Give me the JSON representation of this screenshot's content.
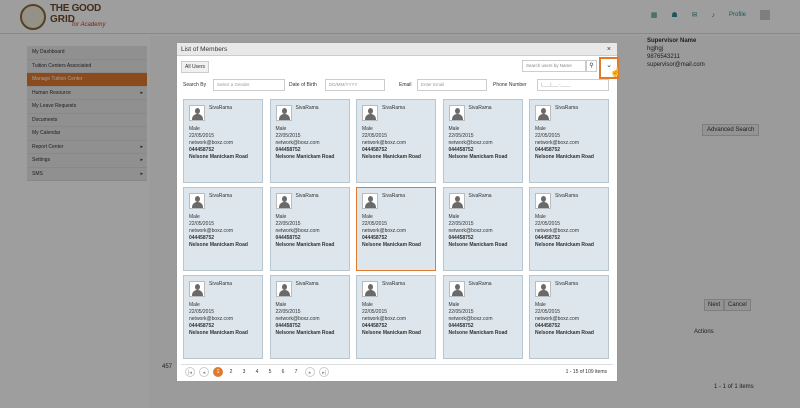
{
  "logo": {
    "line1": "THE GOOD",
    "line2": "GRID",
    "tag": "for Academy"
  },
  "topbar": {
    "profile": "Profile"
  },
  "sidebar": {
    "items": [
      {
        "label": "My Dashboard",
        "arrow": ""
      },
      {
        "label": "Tuition Centers Associated",
        "arrow": ""
      },
      {
        "label": "Manage Tuition Center",
        "arrow": ""
      },
      {
        "label": "Human Resource",
        "arrow": "▸"
      },
      {
        "label": "My Leave Requests",
        "arrow": ""
      },
      {
        "label": "Documents",
        "arrow": ""
      },
      {
        "label": "My Calendar",
        "arrow": ""
      },
      {
        "label": "Report Center",
        "arrow": "▸"
      },
      {
        "label": "Settings",
        "arrow": "▸"
      },
      {
        "label": "SMS",
        "arrow": "▸"
      }
    ]
  },
  "background": {
    "supervisor_title": "Supervisor Name",
    "supervisor_name": "hgjhgj",
    "supervisor_phone": "9876543211",
    "supervisor_email": "supervisor@mail.com",
    "advanced_search": "Advanced Search",
    "next": "Next",
    "cancel": "Cancel",
    "actions": "Actions",
    "row_id": "457",
    "pager_right": "1 - 1 of 1 items"
  },
  "modal": {
    "title": "List of Members",
    "close": "×",
    "all_users": "All Users",
    "search_placeholder": "Search users by Name",
    "filters": {
      "search_by": "Search By",
      "gender_placeholder": "Select a Gender",
      "dob_label": "Date of Birth",
      "dob_placeholder": "DD/MM/YYYY",
      "email_label": "Email",
      "email_placeholder": "Enter Email",
      "phone_label": "Phone Number",
      "phone_placeholder": "(___)___-____"
    },
    "cards": [
      {
        "name": "SivaRama",
        "gender": "Male",
        "date": "22/05/2015",
        "email": "network@boxz.com",
        "phone": "044458752",
        "address": "Nelsone Manickam Road"
      },
      {
        "name": "SivaRama",
        "gender": "Male",
        "date": "22/05/2015",
        "email": "network@boxz.com",
        "phone": "044458752",
        "address": "Nelsone Manickam Road"
      },
      {
        "name": "SivaRama",
        "gender": "Male",
        "date": "22/05/2015",
        "email": "network@boxz.com",
        "phone": "044458752",
        "address": "Nelsone Manickam Road"
      },
      {
        "name": "SivaRama",
        "gender": "Male",
        "date": "22/05/2015",
        "email": "network@boxz.com",
        "phone": "044458752",
        "address": "Nelsone Manickam Road"
      },
      {
        "name": "SivaRama",
        "gender": "Male",
        "date": "22/05/2015",
        "email": "network@boxz.com",
        "phone": "044458752",
        "address": "Nelsone Manickam Road"
      },
      {
        "name": "SivaRama",
        "gender": "Male",
        "date": "22/05/2015",
        "email": "network@boxz.com",
        "phone": "044458752",
        "address": "Nelsone Manickam Road"
      },
      {
        "name": "SivaRama",
        "gender": "Male",
        "date": "22/05/2015",
        "email": "network@boxz.com",
        "phone": "044458752",
        "address": "Nelsone Manickam Road"
      },
      {
        "name": "SivaRama",
        "gender": "Male",
        "date": "22/05/2015",
        "email": "network@boxz.com",
        "phone": "044458752",
        "address": "Nelsone Manickam Road"
      },
      {
        "name": "SivaRama",
        "gender": "Male",
        "date": "22/05/2015",
        "email": "network@boxz.com",
        "phone": "044458752",
        "address": "Nelsone Manickam Road"
      },
      {
        "name": "SivaRama",
        "gender": "Male",
        "date": "22/05/2015",
        "email": "network@boxz.com",
        "phone": "044458752",
        "address": "Nelsone Manickam Road"
      },
      {
        "name": "SivaRama",
        "gender": "Male",
        "date": "22/05/2015",
        "email": "network@boxz.com",
        "phone": "044458752",
        "address": "Nelsone Manickam Road"
      },
      {
        "name": "SivaRama",
        "gender": "Male",
        "date": "22/05/2015",
        "email": "network@boxz.com",
        "phone": "044458752",
        "address": "Nelsone Manickam Road"
      },
      {
        "name": "SivaRama",
        "gender": "Male",
        "date": "22/05/2015",
        "email": "network@boxz.com",
        "phone": "044458752",
        "address": "Nelsone Manickam Road"
      },
      {
        "name": "SivaRama",
        "gender": "Male",
        "date": "22/05/2015",
        "email": "network@boxz.com",
        "phone": "044458752",
        "address": "Nelsone Manickam Road"
      },
      {
        "name": "SivaRama",
        "gender": "Male",
        "date": "22/05/2015",
        "email": "network@boxz.com",
        "phone": "044458752",
        "address": "Nelsone Manickam Road"
      }
    ],
    "pager": {
      "pages": [
        "1",
        "2",
        "3",
        "4",
        "5",
        "6",
        "7"
      ],
      "first": "|◂",
      "prev": "◂",
      "next": "▸",
      "last": "▸|",
      "count": "1 - 15 of 109 items"
    }
  }
}
